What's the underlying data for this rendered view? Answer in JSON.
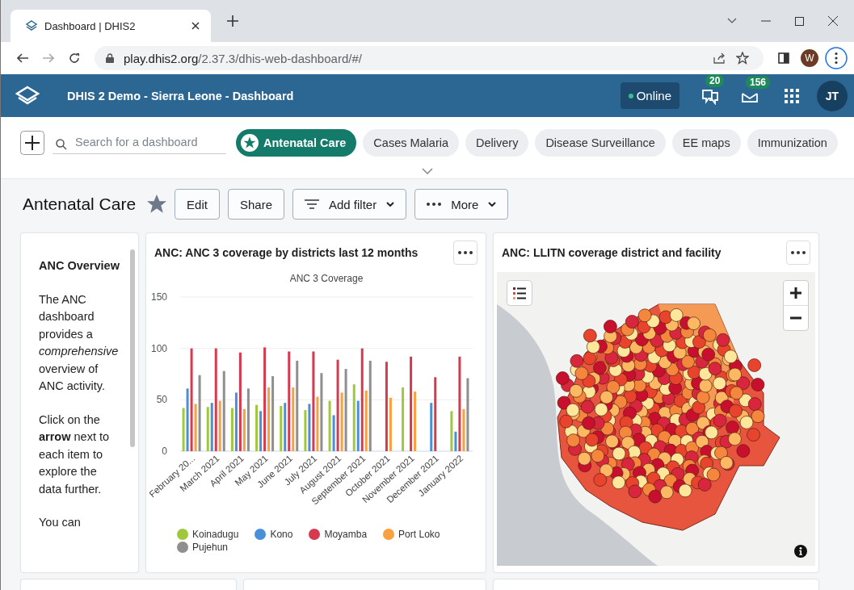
{
  "browser": {
    "tab_title": "Dashboard | DHIS2",
    "url_host": "play.dhis2.org",
    "url_path": "/2.37.3/dhis-web-dashboard/#/",
    "profile_initial": "W"
  },
  "header": {
    "title": "DHIS 2 Demo - Sierra Leone - Dashboard",
    "status": "Online",
    "messages_count": "20",
    "mail_count": "156",
    "user_initials": "JT"
  },
  "dashboards": {
    "search_placeholder": "Search for a dashboard",
    "items": [
      {
        "label": "Antenatal Care",
        "selected": true
      },
      {
        "label": "Cases Malaria",
        "selected": false
      },
      {
        "label": "Delivery",
        "selected": false
      },
      {
        "label": "Disease Surveillance",
        "selected": false
      },
      {
        "label": "EE maps",
        "selected": false
      },
      {
        "label": "Immunization",
        "selected": false
      }
    ]
  },
  "dashboard": {
    "title": "Antenatal Care",
    "starred": true,
    "actions": [
      {
        "kind": "plain",
        "label": "Edit"
      },
      {
        "kind": "plain",
        "label": "Share"
      },
      {
        "kind": "filter",
        "label": "Add filter"
      },
      {
        "kind": "more",
        "label": "More"
      }
    ]
  },
  "text_card": {
    "paragraphs": [
      "**ANC Overview**",
      "The ANC dashboard provides a *comprehensive* overview of ANC activity.",
      "Click on the **arrow** next to each item to explore the data further.",
      "You can"
    ]
  },
  "chart_card": {
    "title": "ANC: ANC 3 coverage by districts last 12 months",
    "chart_data": {
      "type": "bar",
      "title": "ANC 3 Coverage",
      "categories": [
        "February 20...",
        "March 2021",
        "April 2021",
        "May 2021",
        "June 2021",
        "July 2021",
        "August 2021",
        "September 2021",
        "October 2021",
        "November 2021",
        "December 2021",
        "January 2022"
      ],
      "ylim": [
        0,
        150
      ],
      "legend": "bottom",
      "yticks": [
        0,
        50,
        100,
        150
      ],
      "series": [
        {
          "name": "Koinadugu",
          "color": "#a0c83c",
          "values": [
            42,
            43,
            42,
            45,
            44,
            40,
            49,
            65,
            null,
            62,
            null,
            39
          ]
        },
        {
          "name": "Kono",
          "color": "#4a90d9",
          "values": [
            61,
            47,
            57,
            39,
            47,
            46,
            35,
            49,
            null,
            null,
            47,
            19
          ]
        },
        {
          "name": "Moyamba",
          "color": "#d63a4e",
          "values": [
            100,
            100,
            96,
            101,
            97,
            97,
            89,
            100,
            87,
            92,
            72,
            92
          ]
        },
        {
          "name": "Port Loko",
          "color": "#f9a03f",
          "values": [
            46,
            49,
            41,
            62,
            62,
            53,
            57,
            59,
            52,
            58,
            null,
            41
          ]
        },
        {
          "name": "Pujehun",
          "color": "#8f8f8f",
          "values": [
            74,
            78,
            61,
            73,
            88,
            76,
            80,
            88,
            null,
            null,
            null,
            71
          ]
        }
      ]
    }
  },
  "map_card": {
    "title": "ANC: LLITN coverage district and facility"
  }
}
